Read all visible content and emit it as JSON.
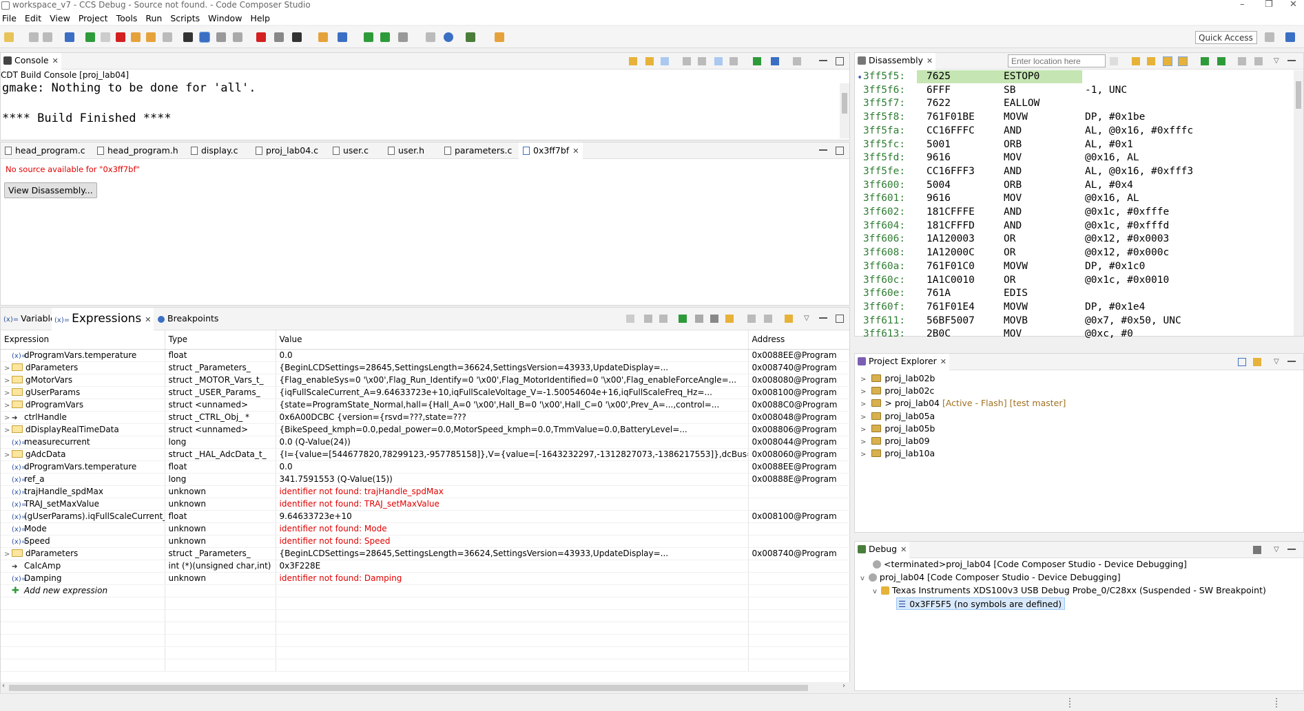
{
  "window": {
    "title": "workspace_v7 - CCS Debug - Source not found. - Code Composer Studio",
    "controls": [
      "–",
      "❐",
      "✕"
    ]
  },
  "menu": [
    "File",
    "Edit",
    "View",
    "Project",
    "Tools",
    "Run",
    "Scripts",
    "Window",
    "Help"
  ],
  "toolbar": {
    "quick_access": "Quick Access"
  },
  "console": {
    "tab_label": "Console",
    "header": "CDT Build Console [proj_lab04]",
    "lines": [
      "gmake: Nothing to be done for 'all'.",
      "",
      "**** Build Finished ****"
    ]
  },
  "editor": {
    "tabs": [
      "head_program.c",
      "head_program.h",
      "display.c",
      "proj_lab04.c",
      "user.c",
      "user.h",
      "parameters.c",
      "0x3ff7bf"
    ],
    "message": "No source available for \"0x3ff7bf\"",
    "button": "View Disassembly..."
  },
  "expressions": {
    "tabs": [
      "Variables",
      "Expressions",
      "Breakpoints"
    ],
    "columns": [
      "Expression",
      "Type",
      "Value",
      "Address"
    ],
    "rows": [
      {
        "expr": "dProgramVars.temperature",
        "type": "float",
        "value": "0.0",
        "addr": "0x0088EE@Program",
        "kind": "x",
        "expand": false,
        "err": false
      },
      {
        "expr": "dParameters",
        "type": "struct _Parameters_",
        "value": "{BeginLCDSettings=28645,SettingsLength=36624,SettingsVersion=43933,UpdateDisplay=...",
        "addr": "0x008740@Program",
        "kind": "s",
        "expand": true,
        "err": false
      },
      {
        "expr": "gMotorVars",
        "type": "struct _MOTOR_Vars_t_",
        "value": "{Flag_enableSys=0 '\\x00',Flag_Run_Identify=0 '\\x00',Flag_MotorIdentified=0 '\\x00',Flag_enableForceAngle=...",
        "addr": "0x008080@Program",
        "kind": "s",
        "expand": true,
        "err": false
      },
      {
        "expr": "gUserParams",
        "type": "struct _USER_Params_",
        "value": "{iqFullScaleCurrent_A=9.64633723e+10,iqFullScaleVoltage_V=-1.50054604e+16,iqFullScaleFreq_Hz=...",
        "addr": "0x008100@Program",
        "kind": "s",
        "expand": true,
        "err": false
      },
      {
        "expr": "dProgramVars",
        "type": "struct <unnamed>",
        "value": "{state=ProgramState_Normal,hall={Hall_A=0 '\\x00',Hall_B=0 '\\x00',Hall_C=0 '\\x00',Prev_A=...,control=...",
        "addr": "0x0088C0@Program",
        "kind": "s",
        "expand": true,
        "err": false
      },
      {
        "expr": "ctrlHandle",
        "type": "struct _CTRL_Obj_ *",
        "value": "0x6A00DCBC {version={rsvd=???,state=???",
        "addr": "0x008048@Program",
        "kind": "p",
        "expand": true,
        "err": false
      },
      {
        "expr": "dDisplayRealTimeData",
        "type": "struct <unnamed>",
        "value": "{BikeSpeed_kmph=0.0,pedal_power=0.0,MotorSpeed_kmph=0.0,TmmValue=0.0,BatteryLevel=...",
        "addr": "0x008806@Program",
        "kind": "s",
        "expand": true,
        "err": false
      },
      {
        "expr": "measurecurrent",
        "type": "long",
        "value": "0.0 (Q-Value(24))",
        "addr": "0x008044@Program",
        "kind": "x",
        "expand": false,
        "err": false
      },
      {
        "expr": "gAdcData",
        "type": "struct _HAL_AdcData_t_",
        "value": "{I={value=[544677820,78299123,-957785158]},V={value=[-1643232297,-1312827073,-1386217553]},dcBus=...",
        "addr": "0x008060@Program",
        "kind": "s",
        "expand": true,
        "err": false
      },
      {
        "expr": "dProgramVars.temperature",
        "type": "float",
        "value": "0.0",
        "addr": "0x0088EE@Program",
        "kind": "x",
        "expand": false,
        "err": false
      },
      {
        "expr": "ref_a",
        "type": "long",
        "value": "341.7591553 (Q-Value(15))",
        "addr": "0x00888E@Program",
        "kind": "x",
        "expand": false,
        "err": false
      },
      {
        "expr": "trajHandle_spdMax",
        "type": "unknown",
        "value": "identifier not found: trajHandle_spdMax",
        "addr": "",
        "kind": "x",
        "expand": false,
        "err": true
      },
      {
        "expr": "TRAJ_setMaxValue",
        "type": "unknown",
        "value": "identifier not found: TRAJ_setMaxValue",
        "addr": "",
        "kind": "x",
        "expand": false,
        "err": true
      },
      {
        "expr": "(gUserParams).iqFullScaleCurrent_A",
        "type": "float",
        "value": "9.64633723e+10",
        "addr": "0x008100@Program",
        "kind": "x",
        "expand": false,
        "err": false
      },
      {
        "expr": "Mode",
        "type": "unknown",
        "value": "identifier not found: Mode",
        "addr": "",
        "kind": "x",
        "expand": false,
        "err": true
      },
      {
        "expr": "Speed",
        "type": "unknown",
        "value": "identifier not found: Speed",
        "addr": "",
        "kind": "x",
        "expand": false,
        "err": true
      },
      {
        "expr": "dParameters",
        "type": "struct _Parameters_",
        "value": "{BeginLCDSettings=28645,SettingsLength=36624,SettingsVersion=43933,UpdateDisplay=...",
        "addr": "0x008740@Program",
        "kind": "s",
        "expand": true,
        "err": false
      },
      {
        "expr": "CalcAmp",
        "type": "int (*)(unsigned char,int)",
        "value": "0x3F228E",
        "addr": "",
        "kind": "p",
        "expand": false,
        "err": false
      },
      {
        "expr": "Damping",
        "type": "unknown",
        "value": "identifier not found: Damping",
        "addr": "",
        "kind": "x",
        "expand": false,
        "err": true
      }
    ],
    "add_new": "Add new expression"
  },
  "disassembly": {
    "tab_label": "Disassembly",
    "location_placeholder": "Enter location here",
    "rows": [
      [
        "3ff5f5:",
        "7625",
        "ESTOP0",
        ""
      ],
      [
        "3ff5f6:",
        "6FFF",
        "SB",
        "-1, UNC"
      ],
      [
        "3ff5f7:",
        "7622",
        "EALLOW",
        ""
      ],
      [
        "3ff5f8:",
        "761F01BE",
        "MOVW",
        "DP, #0x1be"
      ],
      [
        "3ff5fa:",
        "CC16FFFC",
        "AND",
        "AL, @0x16, #0xfffc"
      ],
      [
        "3ff5fc:",
        "5001",
        "ORB",
        "AL, #0x1"
      ],
      [
        "3ff5fd:",
        "9616",
        "MOV",
        "@0x16, AL"
      ],
      [
        "3ff5fe:",
        "CC16FFF3",
        "AND",
        "AL, @0x16, #0xfff3"
      ],
      [
        "3ff600:",
        "5004",
        "ORB",
        "AL, #0x4"
      ],
      [
        "3ff601:",
        "9616",
        "MOV",
        "@0x16, AL"
      ],
      [
        "3ff602:",
        "181CFFFE",
        "AND",
        "@0x1c, #0xfffe"
      ],
      [
        "3ff604:",
        "181CFFFD",
        "AND",
        "@0x1c, #0xfffd"
      ],
      [
        "3ff606:",
        "1A120003",
        "OR",
        "@0x12, #0x0003"
      ],
      [
        "3ff608:",
        "1A12000C",
        "OR",
        "@0x12, #0x000c"
      ],
      [
        "3ff60a:",
        "761F01C0",
        "MOVW",
        "DP, #0x1c0"
      ],
      [
        "3ff60c:",
        "1A1C0010",
        "OR",
        "@0x1c, #0x0010"
      ],
      [
        "3ff60e:",
        "761A",
        "EDIS",
        ""
      ],
      [
        "3ff60f:",
        "761F01E4",
        "MOVW",
        "DP, #0x1e4"
      ],
      [
        "3ff611:",
        "56BF5007",
        "MOVB",
        "@0x7, #0x50, UNC"
      ],
      [
        "3ff613:",
        "2B0C",
        "MOV",
        "@0xc, #0"
      ]
    ]
  },
  "project_explorer": {
    "tab_label": "Project Explorer",
    "items": [
      {
        "name": "proj_lab02b",
        "suffix": ""
      },
      {
        "name": "proj_lab02c",
        "suffix": ""
      },
      {
        "name": "> proj_lab04",
        "suffix": "[Active - Flash] [test master]"
      },
      {
        "name": "proj_lab05a",
        "suffix": ""
      },
      {
        "name": "proj_lab05b",
        "suffix": ""
      },
      {
        "name": "proj_lab09",
        "suffix": ""
      },
      {
        "name": "proj_lab10a",
        "suffix": ""
      }
    ]
  },
  "debug": {
    "tab_label": "Debug",
    "items": [
      "<terminated>proj_lab04 [Code Composer Studio - Device Debugging]",
      "proj_lab04 [Code Composer Studio - Device Debugging]",
      "Texas Instruments XDS100v3 USB Debug Probe_0/C28xx (Suspended - SW Breakpoint)",
      "0x3FF5F5  (no symbols are defined)"
    ]
  }
}
